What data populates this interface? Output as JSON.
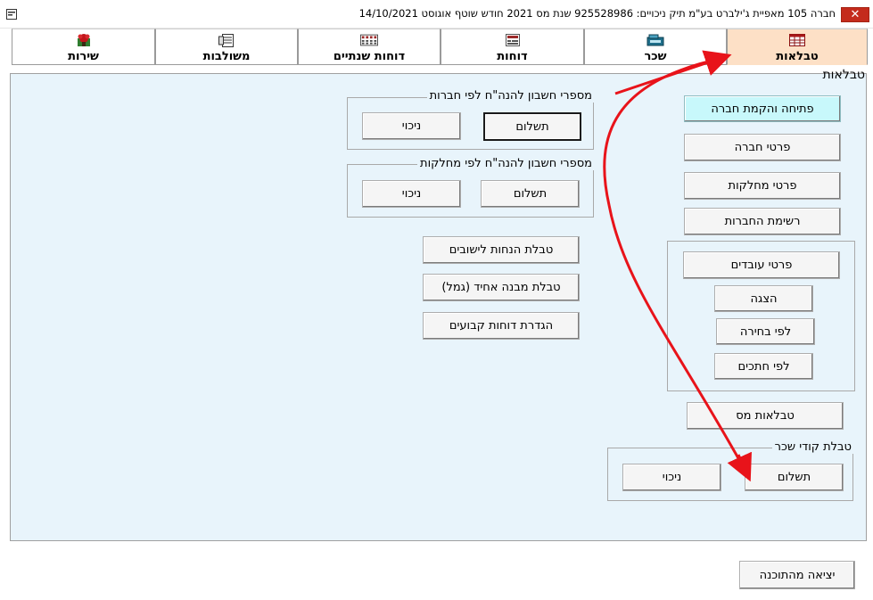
{
  "window": {
    "title": "חברה 105 מאפיית ג'ילברט בע\"מ  תיק ניכויים: 925528986  שנת מס 2021  חודש שוטף אוגוסט  14/10/2021",
    "close_symbol": "✕"
  },
  "tabs": [
    {
      "label": "טבלאות",
      "icon": "table-icon",
      "active": true
    },
    {
      "label": "שכר",
      "icon": "cash-register-icon",
      "active": false
    },
    {
      "label": "דוחות",
      "icon": "report-icon",
      "active": false
    },
    {
      "label": "דוחות שנתיים",
      "icon": "calendar-report-icon",
      "active": false
    },
    {
      "label": "משולבות",
      "icon": "combined-icon",
      "active": false
    },
    {
      "label": "שירות",
      "icon": "service-icon",
      "active": false
    }
  ],
  "panel": {
    "title": "טבלאות"
  },
  "company_column": {
    "open_company": "פתיחה והקמת חברה",
    "company_details": "פרטי חברה",
    "department_details": "פרטי מחלקות",
    "company_list": "רשימת החברות"
  },
  "employees_group": {
    "employee_details": "פרטי עובדים",
    "show": "הצגה",
    "by_selection": "לפי בחירה",
    "by_sections": "לפי חתכים"
  },
  "tax_tables": "טבלאות מס",
  "salary_codes_group": {
    "title": "טבלת קודי שכר",
    "payment": "תשלום",
    "deduction": "ניכוי"
  },
  "accounts_by_company": {
    "title": "מספרי חשבון להנה\"ח לפי חברות",
    "payment": "תשלום",
    "deduction": "ניכוי"
  },
  "accounts_by_department": {
    "title": "מספרי חשבון להנה\"ח לפי מחלקות",
    "payment": "תשלום",
    "deduction": "ניכוי"
  },
  "middle_buttons": {
    "settlement_discounts": "טבלת הנחות לישובים",
    "uniform_structure": "טבלת מבנה אחיד (גמל)",
    "fixed_reports": "הגדרת דוחות קבועים"
  },
  "exit_button": "יציאה מהתוכנה",
  "colors": {
    "active_tab": "#fde0c6",
    "panel_bg": "#e8f4fb",
    "highlight_button": "#c8f8fb",
    "annotation_arrow": "#e8131a",
    "close_button": "#c42b1c"
  }
}
